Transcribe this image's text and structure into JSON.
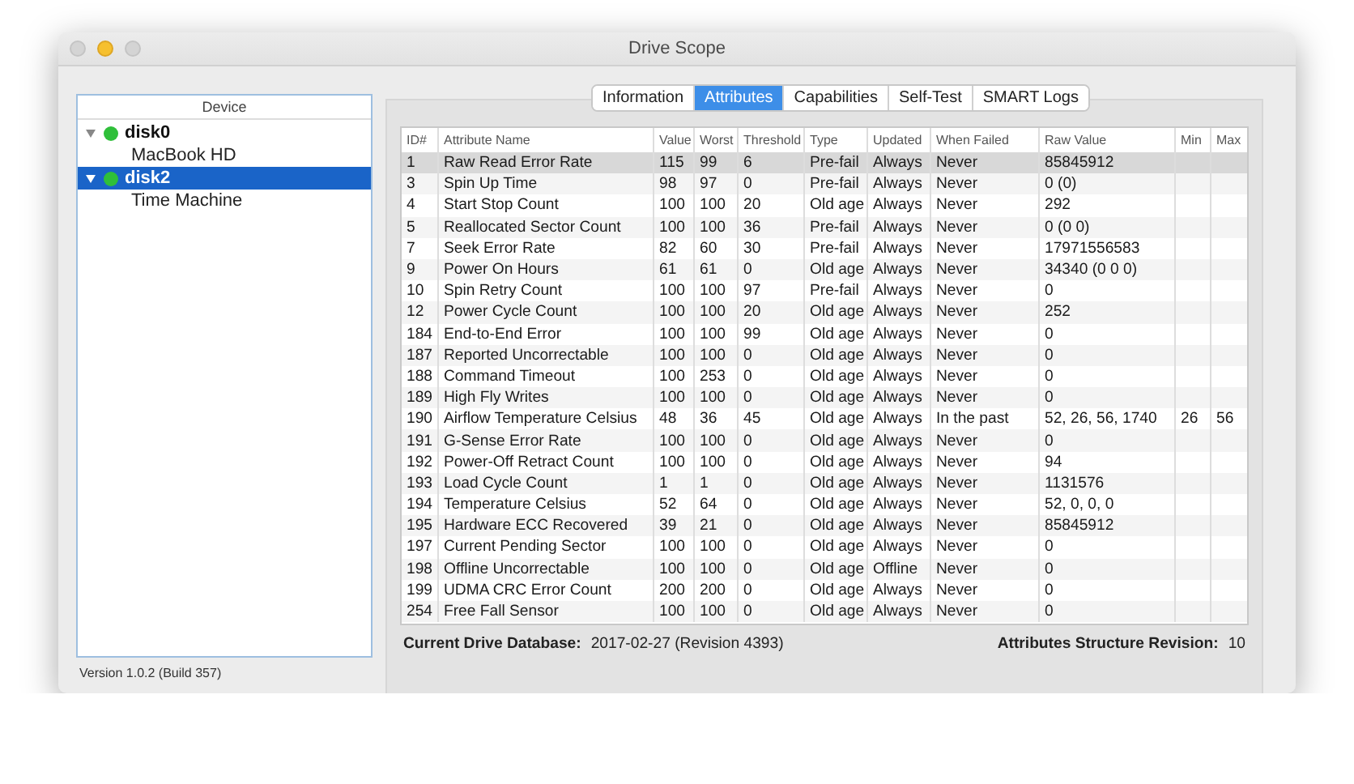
{
  "window": {
    "title": "Drive Scope"
  },
  "sidebar": {
    "header": "Device",
    "items": [
      {
        "label": "disk0",
        "color": "#2fbf3a",
        "expanded": true,
        "selected": false,
        "children": [
          {
            "label": "MacBook HD",
            "selected": false
          }
        ]
      },
      {
        "label": "disk2",
        "color": "#2fbf3a",
        "expanded": true,
        "selected": true,
        "children": [
          {
            "label": "Time Machine",
            "selected": false
          }
        ]
      }
    ]
  },
  "tabs": [
    {
      "label": "Information",
      "selected": false
    },
    {
      "label": "Attributes",
      "selected": true
    },
    {
      "label": "Capabilities",
      "selected": false
    },
    {
      "label": "Self-Test",
      "selected": false
    },
    {
      "label": "SMART Logs",
      "selected": false
    }
  ],
  "table": {
    "columns": [
      "ID#",
      "Attribute Name",
      "Value",
      "Worst",
      "Threshold",
      "Type",
      "Updated",
      "When Failed",
      "Raw Value",
      "Min",
      "Max"
    ],
    "rows": [
      {
        "selected": true,
        "cells": [
          "1",
          "Raw Read Error Rate",
          "115",
          "99",
          "6",
          "Pre-fail",
          "Always",
          "Never",
          "85845912",
          "",
          ""
        ]
      },
      {
        "selected": false,
        "cells": [
          "3",
          "Spin Up Time",
          "98",
          "97",
          "0",
          "Pre-fail",
          "Always",
          "Never",
          "0 (0)",
          "",
          ""
        ]
      },
      {
        "selected": false,
        "cells": [
          "4",
          "Start Stop Count",
          "100",
          "100",
          "20",
          "Old age",
          "Always",
          "Never",
          "292",
          "",
          ""
        ]
      },
      {
        "selected": false,
        "cells": [
          "5",
          "Reallocated Sector Count",
          "100",
          "100",
          "36",
          "Pre-fail",
          "Always",
          "Never",
          "0 (0 0)",
          "",
          ""
        ]
      },
      {
        "selected": false,
        "cells": [
          "7",
          "Seek Error Rate",
          "82",
          "60",
          "30",
          "Pre-fail",
          "Always",
          "Never",
          "17971556583",
          "",
          ""
        ]
      },
      {
        "selected": false,
        "cells": [
          "9",
          "Power On Hours",
          "61",
          "61",
          "0",
          "Old age",
          "Always",
          "Never",
          "34340 (0 0 0)",
          "",
          ""
        ]
      },
      {
        "selected": false,
        "cells": [
          "10",
          "Spin Retry Count",
          "100",
          "100",
          "97",
          "Pre-fail",
          "Always",
          "Never",
          "0",
          "",
          ""
        ]
      },
      {
        "selected": false,
        "cells": [
          "12",
          "Power Cycle Count",
          "100",
          "100",
          "20",
          "Old age",
          "Always",
          "Never",
          "252",
          "",
          ""
        ]
      },
      {
        "selected": false,
        "cells": [
          "184",
          "End-to-End Error",
          "100",
          "100",
          "99",
          "Old age",
          "Always",
          "Never",
          "0",
          "",
          ""
        ]
      },
      {
        "selected": false,
        "cells": [
          "187",
          "Reported Uncorrectable",
          "100",
          "100",
          "0",
          "Old age",
          "Always",
          "Never",
          "0",
          "",
          ""
        ]
      },
      {
        "selected": false,
        "cells": [
          "188",
          "Command Timeout",
          "100",
          "253",
          "0",
          "Old age",
          "Always",
          "Never",
          "0",
          "",
          ""
        ]
      },
      {
        "selected": false,
        "cells": [
          "189",
          "High Fly Writes",
          "100",
          "100",
          "0",
          "Old age",
          "Always",
          "Never",
          "0",
          "",
          ""
        ]
      },
      {
        "selected": false,
        "cells": [
          "190",
          "Airflow Temperature Celsius",
          "48",
          "36",
          "45",
          "Old age",
          "Always",
          "In the past",
          "52, 26, 56, 1740",
          "26",
          "56"
        ]
      },
      {
        "selected": false,
        "cells": [
          "191",
          "G-Sense Error Rate",
          "100",
          "100",
          "0",
          "Old age",
          "Always",
          "Never",
          "0",
          "",
          ""
        ]
      },
      {
        "selected": false,
        "cells": [
          "192",
          "Power-Off Retract Count",
          "100",
          "100",
          "0",
          "Old age",
          "Always",
          "Never",
          "94",
          "",
          ""
        ]
      },
      {
        "selected": false,
        "cells": [
          "193",
          "Load Cycle Count",
          "1",
          "1",
          "0",
          "Old age",
          "Always",
          "Never",
          "1131576",
          "",
          ""
        ]
      },
      {
        "selected": false,
        "cells": [
          "194",
          "Temperature Celsius",
          "52",
          "64",
          "0",
          "Old age",
          "Always",
          "Never",
          "52, 0, 0, 0",
          "",
          ""
        ]
      },
      {
        "selected": false,
        "cells": [
          "195",
          "Hardware ECC Recovered",
          "39",
          "21",
          "0",
          "Old age",
          "Always",
          "Never",
          "85845912",
          "",
          ""
        ]
      },
      {
        "selected": false,
        "cells": [
          "197",
          "Current Pending Sector",
          "100",
          "100",
          "0",
          "Old age",
          "Always",
          "Never",
          "0",
          "",
          ""
        ]
      },
      {
        "selected": false,
        "cells": [
          "198",
          "Offline Uncorrectable",
          "100",
          "100",
          "0",
          "Old age",
          "Offline",
          "Never",
          "0",
          "",
          ""
        ]
      },
      {
        "selected": false,
        "cells": [
          "199",
          "UDMA CRC Error Count",
          "200",
          "200",
          "0",
          "Old age",
          "Always",
          "Never",
          "0",
          "",
          ""
        ]
      },
      {
        "selected": false,
        "cells": [
          "254",
          "Free Fall Sensor",
          "100",
          "100",
          "0",
          "Old age",
          "Always",
          "Never",
          "0",
          "",
          ""
        ]
      }
    ]
  },
  "footer": {
    "database_label": "Current Drive Database:",
    "database_value": "2017-02-27 (Revision 4393)",
    "revision_label": "Attributes Structure Revision:",
    "revision_value": "10"
  },
  "status_bar": {
    "version": "Version 1.0.2 (Build 357)"
  }
}
